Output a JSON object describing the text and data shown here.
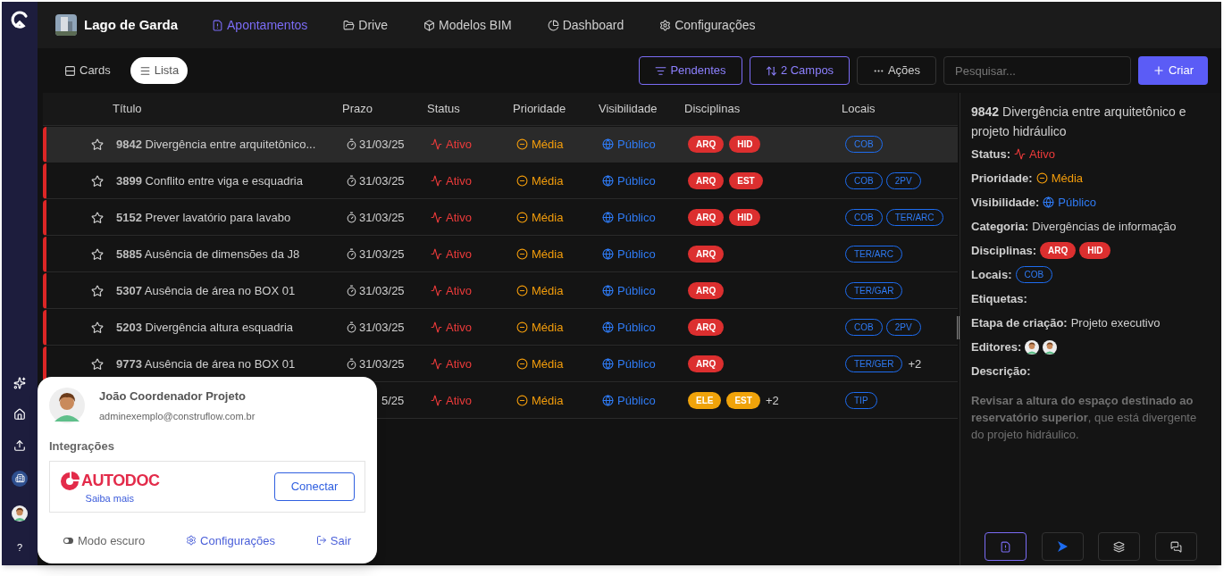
{
  "rail": {
    "help": "?"
  },
  "project": {
    "name": "Lago de Garda"
  },
  "nav": [
    {
      "label": "Apontamentos",
      "selected": true
    },
    {
      "label": "Drive",
      "selected": false
    },
    {
      "label": "Modelos BIM",
      "selected": false
    },
    {
      "label": "Dashboard",
      "selected": false
    },
    {
      "label": "Configurações",
      "selected": false
    }
  ],
  "views": [
    {
      "label": "Cards",
      "selected": false
    },
    {
      "label": "Lista",
      "selected": true
    }
  ],
  "toolbar": {
    "filter": "Pendentes",
    "sort": "2 Campos",
    "actions": "Ações",
    "search_placeholder": "Pesquisar...",
    "create": "Criar"
  },
  "table": {
    "columns": [
      "Título",
      "Prazo",
      "Status",
      "Prioridade",
      "Visibilidade",
      "Disciplinas",
      "Locais"
    ],
    "rows": [
      {
        "selected": true,
        "starred": false,
        "title": "**9842** Divergência entre arquitetônico...",
        "prazo": "31/03/25",
        "status": "Ativo",
        "prioridade": "Média",
        "visibilidade": "Público",
        "disciplinas": [
          {
            "label": "ARQ",
            "color": "#dc2f2f"
          },
          {
            "label": "HID",
            "color": "#dc2f2f"
          }
        ],
        "locais": [
          "COB"
        ]
      },
      {
        "selected": false,
        "starred": false,
        "title": "**3899** Conflito entre viga e esquadria",
        "prazo": "31/03/25",
        "status": "Ativo",
        "prioridade": "Média",
        "visibilidade": "Público",
        "disciplinas": [
          {
            "label": "ARQ",
            "color": "#dc2f2f"
          },
          {
            "label": "EST",
            "color": "#dc2f2f"
          }
        ],
        "locais": [
          "COB",
          "2PV"
        ]
      },
      {
        "selected": false,
        "starred": false,
        "title": "**5152** Prever lavatório para lavabo",
        "prazo": "31/03/25",
        "status": "Ativo",
        "prioridade": "Média",
        "visibilidade": "Público",
        "disciplinas": [
          {
            "label": "ARQ",
            "color": "#dc2f2f"
          },
          {
            "label": "HID",
            "color": "#dc2f2f"
          }
        ],
        "locais": [
          "COB",
          "TER/ARC"
        ]
      },
      {
        "selected": false,
        "starred": false,
        "title": "**5885** Ausência de dimensões da J8",
        "prazo": "31/03/25",
        "status": "Ativo",
        "prioridade": "Média",
        "visibilidade": "Público",
        "disciplinas": [
          {
            "label": "ARQ",
            "color": "#dc2f2f"
          }
        ],
        "locais": [
          "TER/ARC"
        ]
      },
      {
        "selected": false,
        "starred": false,
        "title": "**5307** Ausência de área no BOX 01",
        "prazo": "31/03/25",
        "status": "Ativo",
        "prioridade": "Média",
        "visibilidade": "Público",
        "disciplinas": [
          {
            "label": "ARQ",
            "color": "#dc2f2f"
          }
        ],
        "locais": [
          "TER/GAR"
        ]
      },
      {
        "selected": false,
        "starred": false,
        "title": "**5203** Divergência altura esquadria",
        "prazo": "31/03/25",
        "status": "Ativo",
        "prioridade": "Média",
        "visibilidade": "Público",
        "disciplinas": [
          {
            "label": "ARQ",
            "color": "#dc2f2f"
          }
        ],
        "locais": [
          "COB",
          "2PV"
        ]
      },
      {
        "selected": false,
        "starred": false,
        "title": "**9773** Ausência de área no BOX 01",
        "prazo": "31/03/25",
        "status": "Ativo",
        "prioridade": "Média",
        "visibilidade": "Público",
        "disciplinas": [
          {
            "label": "ARQ",
            "color": "#dc2f2f"
          }
        ],
        "locais": [
          "TER/GER"
        ],
        "locais_more": "+2"
      },
      {
        "selected": false,
        "prazo": "5/25",
        "status": "Ativo",
        "prioridade": "Média",
        "visibilidade": "Público",
        "disciplinas": [
          {
            "label": "ELE",
            "color": "#f0a30a"
          },
          {
            "label": "EST",
            "color": "#f0a30a"
          }
        ],
        "disciplinas_more": "+2",
        "locais": [
          "TIP"
        ]
      }
    ]
  },
  "detail": {
    "title": "**9842** Divergência entre arquitetônico e projeto hidráulico",
    "fields": [
      {
        "kind": "status",
        "label": "Status:",
        "value": "Ativo"
      },
      {
        "kind": "priority",
        "label": "Prioridade:",
        "value": "Média"
      },
      {
        "kind": "visibility",
        "label": "Visibilidade:",
        "value": "Público"
      },
      {
        "kind": "text",
        "label": "Categoria:",
        "value": "Divergências de informação"
      },
      {
        "kind": "tags",
        "label": "Disciplinas:",
        "tags": [
          {
            "label": "ARQ",
            "color": "#dc2f2f"
          },
          {
            "label": "HID",
            "color": "#dc2f2f"
          }
        ]
      },
      {
        "kind": "places",
        "label": "Locais:",
        "tags": [
          {
            "label": "COB"
          }
        ]
      },
      {
        "kind": "empty",
        "label": "Etiquetas:"
      },
      {
        "kind": "text",
        "label": "Etapa de criação:",
        "value": "Projeto executivo"
      },
      {
        "kind": "editors",
        "label": "Editores:"
      },
      {
        "kind": "empty",
        "label": "Descrição:"
      }
    ],
    "description": "**Revisar a altura do espaço destinado ao reservatório superior**, que está divergente do projeto hidráulico.",
    "tools": [
      {
        "selected": true
      },
      {
        "selected": false
      },
      {
        "selected": false
      },
      {
        "selected": false
      }
    ]
  },
  "user_menu": {
    "name": "João Coordenador Projeto",
    "email": "adminexemplo@construflow.com.br",
    "section": "Integrações",
    "integration": {
      "brand": "AUTODOC",
      "link": "Saiba mais",
      "button": "Conectar"
    },
    "dark_mode": {
      "label": "Modo escuro",
      "on": false
    },
    "settings": "Configurações",
    "logout": "Sair"
  }
}
